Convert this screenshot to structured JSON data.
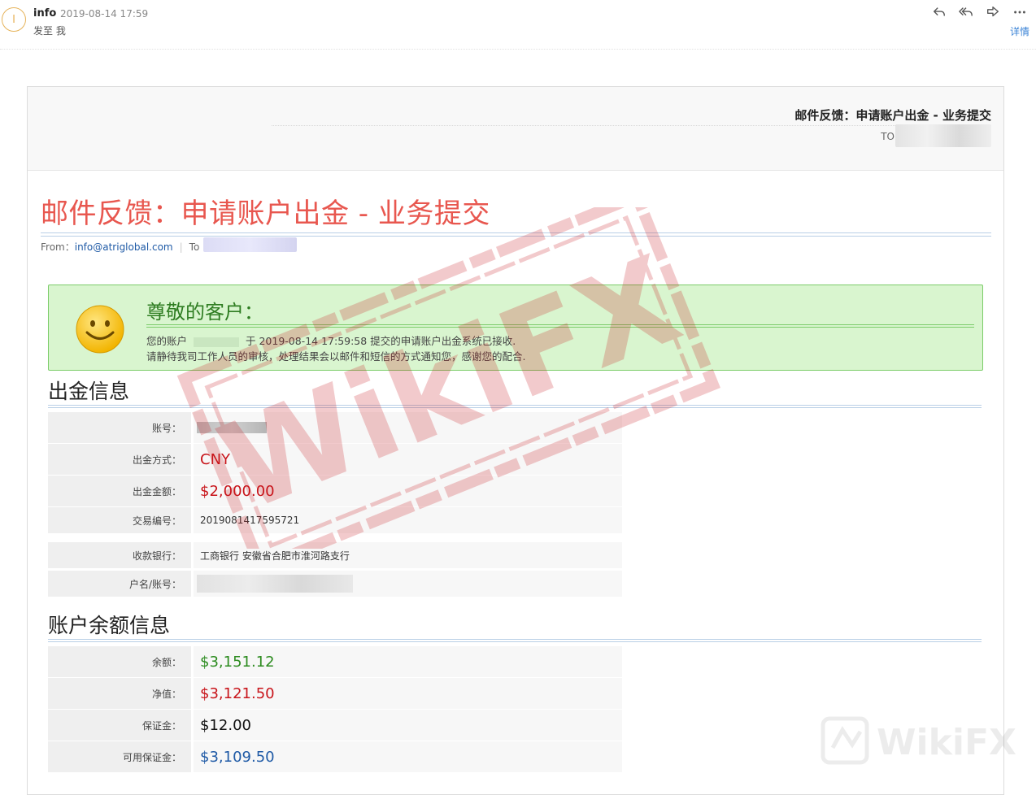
{
  "mail_client": {
    "sender_initial": "I",
    "sender_name": "info",
    "sent_time": "2019-08-14 17:59",
    "recipient_line": "发至 我",
    "details_label": "详情",
    "actions": [
      "reply-icon",
      "reply-all-icon",
      "forward-icon",
      "more-icon"
    ]
  },
  "email": {
    "header_title": "邮件反馈：申请账户出金 - 业务提交",
    "header_to_label": "TO：",
    "title": "邮件反馈：申请账户出金 - 业务提交",
    "from_label": "From：",
    "from_address": "info@atriglobal.com",
    "to_label": "To"
  },
  "notice": {
    "greeting": "尊敬的客户：",
    "line1_prefix": "您的账户",
    "line1_suffix": "于 2019-08-14 17:59:58 提交的申请账户出金系统已接收.",
    "line2": "请静待我司工作人员的审核，处理结果会以邮件和短信的方式通知您，感谢您的配合."
  },
  "withdrawal": {
    "section_title": "出金信息",
    "rows": [
      {
        "label": "账号：",
        "value": ""
      },
      {
        "label": "出金方式：",
        "value": "CNY"
      },
      {
        "label": "出金金额：",
        "value": "$2,000.00"
      },
      {
        "label": "交易编号：",
        "value": "2019081417595721"
      }
    ],
    "bank_rows": [
      {
        "label": "收款银行：",
        "value": "工商银行 安徽省合肥市淮河路支行"
      },
      {
        "label": "户名/账号：",
        "value": ""
      }
    ]
  },
  "balance": {
    "section_title": "账户余额信息",
    "rows": [
      {
        "label": "余额：",
        "value": "$3,151.12"
      },
      {
        "label": "净值：",
        "value": "$3,121.50"
      },
      {
        "label": "保证金：",
        "value": "$12.00"
      },
      {
        "label": "可用保证金：",
        "value": "$3,109.50"
      }
    ]
  },
  "watermark": {
    "stamp_text": "WikiFX",
    "logo_text": "WikiFX"
  },
  "colors": {
    "title_red": "#e8574f",
    "value_red": "#c8141a",
    "value_green": "#2c8b1f",
    "value_blue": "#1f5aa6",
    "notice_bg": "#d9f5cf",
    "link_blue": "#3a83d6"
  }
}
